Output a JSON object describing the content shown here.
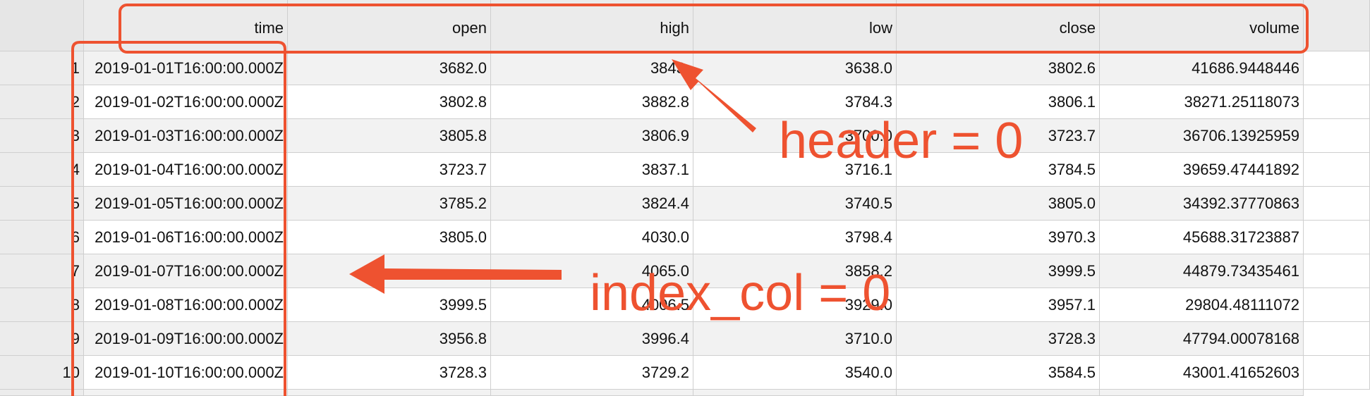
{
  "table": {
    "columns": [
      "time",
      "open",
      "high",
      "low",
      "close",
      "volume"
    ],
    "rows": [
      {
        "index": "1",
        "time": "2019-01-01T16:00:00.000Z",
        "open": "3682.0",
        "high": "3843.",
        "low": "3638.0",
        "close": "3802.6",
        "volume": "41686.9448446"
      },
      {
        "index": "2",
        "time": "2019-01-02T16:00:00.000Z",
        "open": "3802.8",
        "high": "3882.8",
        "low": "3784.3",
        "close": "3806.1",
        "volume": "38271.25118073"
      },
      {
        "index": "3",
        "time": "2019-01-03T16:00:00.000Z",
        "open": "3805.8",
        "high": "3806.9",
        "low": "3700.0",
        "close": "3723.7",
        "volume": "36706.13925959"
      },
      {
        "index": "4",
        "time": "2019-01-04T16:00:00.000Z",
        "open": "3723.7",
        "high": "3837.1",
        "low": "3716.1",
        "close": "3784.5",
        "volume": "39659.47441892"
      },
      {
        "index": "5",
        "time": "2019-01-05T16:00:00.000Z",
        "open": "3785.2",
        "high": "3824.4",
        "low": "3740.5",
        "close": "3805.0",
        "volume": "34392.37770863"
      },
      {
        "index": "6",
        "time": "2019-01-06T16:00:00.000Z",
        "open": "3805.0",
        "high": "4030.0",
        "low": "3798.4",
        "close": "3970.3",
        "volume": "45688.31723887"
      },
      {
        "index": "7",
        "time": "2019-01-07T16:00:00.000Z",
        "open": "",
        "high": "4065.0",
        "low": "3858.2",
        "close": "3999.5",
        "volume": "44879.73435461"
      },
      {
        "index": "8",
        "time": "2019-01-08T16:00:00.000Z",
        "open": "3999.5",
        "high": "4006.5",
        "low": "3929.0",
        "close": "3957.1",
        "volume": "29804.48111072"
      },
      {
        "index": "9",
        "time": "2019-01-09T16:00:00.000Z",
        "open": "3956.8",
        "high": "3996.4",
        "low": "3710.0",
        "close": "3728.3",
        "volume": "47794.00078168"
      },
      {
        "index": "10",
        "time": "2019-01-10T16:00:00.000Z",
        "open": "3728.3",
        "high": "3729.2",
        "low": "3540.0",
        "close": "3584.5",
        "volume": "43001.41652603"
      }
    ]
  },
  "annotations": {
    "header_label": "header = 0",
    "index_col_label": "index_col = 0",
    "color": "#ee5230"
  }
}
